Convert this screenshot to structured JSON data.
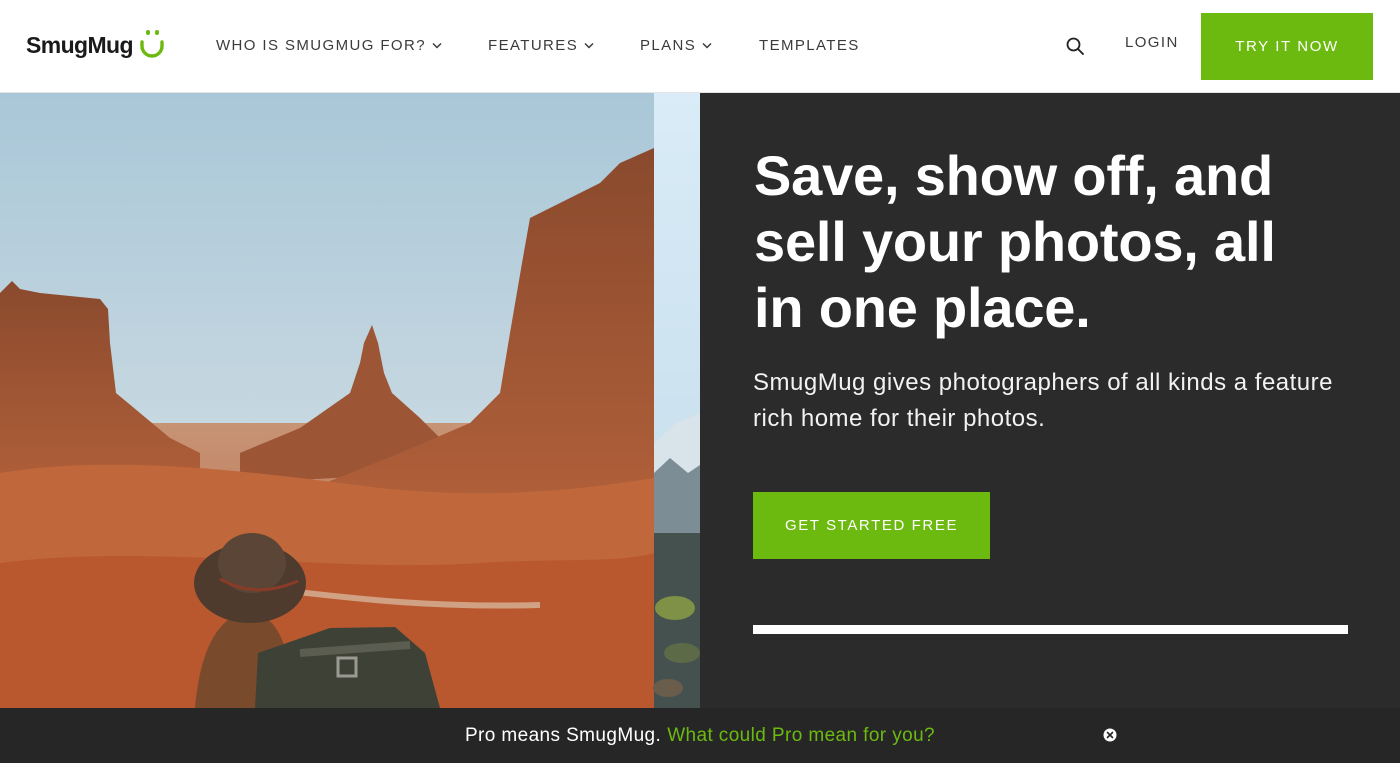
{
  "header": {
    "logo_text": "SmugMug",
    "nav": {
      "who": "WHO IS SMUGMUG FOR?",
      "features": "FEATURES",
      "plans": "PLANS",
      "templates": "TEMPLATES"
    },
    "search_icon": "search-icon",
    "login_label": "LOGIN",
    "try_label": "TRY IT NOW"
  },
  "hero": {
    "headline": "Save, show off, and sell your photos, all in one place.",
    "subtext": "SmugMug gives photographers of all kinds a feature rich home for their photos.",
    "cta_label": "GET STARTED FREE",
    "slide_progress": 1.0
  },
  "banner": {
    "text": "Pro means SmugMug.",
    "link": "What could Pro mean for you?",
    "close_icon": "close-circle-icon"
  },
  "colors": {
    "brand_green": "#6cba10",
    "panel_dark": "#2b2b2b",
    "banner_dark": "#262626",
    "nav_text": "#3b3b3b"
  }
}
